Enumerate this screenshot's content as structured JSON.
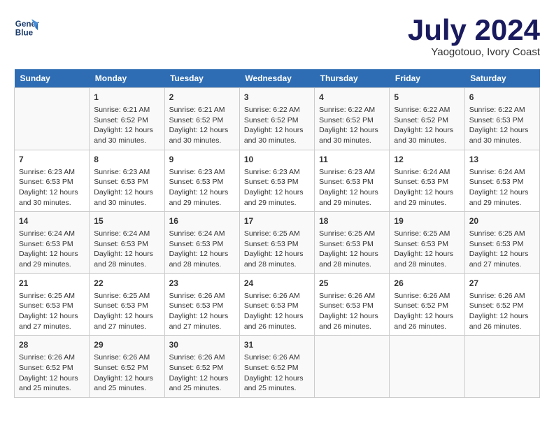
{
  "header": {
    "logo_line1": "General",
    "logo_line2": "Blue",
    "month": "July 2024",
    "location": "Yaogotouo, Ivory Coast"
  },
  "weekdays": [
    "Sunday",
    "Monday",
    "Tuesday",
    "Wednesday",
    "Thursday",
    "Friday",
    "Saturday"
  ],
  "weeks": [
    [
      {
        "day": "",
        "info": ""
      },
      {
        "day": "1",
        "info": "Sunrise: 6:21 AM\nSunset: 6:52 PM\nDaylight: 12 hours\nand 30 minutes."
      },
      {
        "day": "2",
        "info": "Sunrise: 6:21 AM\nSunset: 6:52 PM\nDaylight: 12 hours\nand 30 minutes."
      },
      {
        "day": "3",
        "info": "Sunrise: 6:22 AM\nSunset: 6:52 PM\nDaylight: 12 hours\nand 30 minutes."
      },
      {
        "day": "4",
        "info": "Sunrise: 6:22 AM\nSunset: 6:52 PM\nDaylight: 12 hours\nand 30 minutes."
      },
      {
        "day": "5",
        "info": "Sunrise: 6:22 AM\nSunset: 6:52 PM\nDaylight: 12 hours\nand 30 minutes."
      },
      {
        "day": "6",
        "info": "Sunrise: 6:22 AM\nSunset: 6:53 PM\nDaylight: 12 hours\nand 30 minutes."
      }
    ],
    [
      {
        "day": "7",
        "info": "Sunrise: 6:23 AM\nSunset: 6:53 PM\nDaylight: 12 hours\nand 30 minutes."
      },
      {
        "day": "8",
        "info": "Sunrise: 6:23 AM\nSunset: 6:53 PM\nDaylight: 12 hours\nand 30 minutes."
      },
      {
        "day": "9",
        "info": "Sunrise: 6:23 AM\nSunset: 6:53 PM\nDaylight: 12 hours\nand 29 minutes."
      },
      {
        "day": "10",
        "info": "Sunrise: 6:23 AM\nSunset: 6:53 PM\nDaylight: 12 hours\nand 29 minutes."
      },
      {
        "day": "11",
        "info": "Sunrise: 6:23 AM\nSunset: 6:53 PM\nDaylight: 12 hours\nand 29 minutes."
      },
      {
        "day": "12",
        "info": "Sunrise: 6:24 AM\nSunset: 6:53 PM\nDaylight: 12 hours\nand 29 minutes."
      },
      {
        "day": "13",
        "info": "Sunrise: 6:24 AM\nSunset: 6:53 PM\nDaylight: 12 hours\nand 29 minutes."
      }
    ],
    [
      {
        "day": "14",
        "info": "Sunrise: 6:24 AM\nSunset: 6:53 PM\nDaylight: 12 hours\nand 29 minutes."
      },
      {
        "day": "15",
        "info": "Sunrise: 6:24 AM\nSunset: 6:53 PM\nDaylight: 12 hours\nand 28 minutes."
      },
      {
        "day": "16",
        "info": "Sunrise: 6:24 AM\nSunset: 6:53 PM\nDaylight: 12 hours\nand 28 minutes."
      },
      {
        "day": "17",
        "info": "Sunrise: 6:25 AM\nSunset: 6:53 PM\nDaylight: 12 hours\nand 28 minutes."
      },
      {
        "day": "18",
        "info": "Sunrise: 6:25 AM\nSunset: 6:53 PM\nDaylight: 12 hours\nand 28 minutes."
      },
      {
        "day": "19",
        "info": "Sunrise: 6:25 AM\nSunset: 6:53 PM\nDaylight: 12 hours\nand 28 minutes."
      },
      {
        "day": "20",
        "info": "Sunrise: 6:25 AM\nSunset: 6:53 PM\nDaylight: 12 hours\nand 27 minutes."
      }
    ],
    [
      {
        "day": "21",
        "info": "Sunrise: 6:25 AM\nSunset: 6:53 PM\nDaylight: 12 hours\nand 27 minutes."
      },
      {
        "day": "22",
        "info": "Sunrise: 6:25 AM\nSunset: 6:53 PM\nDaylight: 12 hours\nand 27 minutes."
      },
      {
        "day": "23",
        "info": "Sunrise: 6:26 AM\nSunset: 6:53 PM\nDaylight: 12 hours\nand 27 minutes."
      },
      {
        "day": "24",
        "info": "Sunrise: 6:26 AM\nSunset: 6:53 PM\nDaylight: 12 hours\nand 26 minutes."
      },
      {
        "day": "25",
        "info": "Sunrise: 6:26 AM\nSunset: 6:53 PM\nDaylight: 12 hours\nand 26 minutes."
      },
      {
        "day": "26",
        "info": "Sunrise: 6:26 AM\nSunset: 6:52 PM\nDaylight: 12 hours\nand 26 minutes."
      },
      {
        "day": "27",
        "info": "Sunrise: 6:26 AM\nSunset: 6:52 PM\nDaylight: 12 hours\nand 26 minutes."
      }
    ],
    [
      {
        "day": "28",
        "info": "Sunrise: 6:26 AM\nSunset: 6:52 PM\nDaylight: 12 hours\nand 25 minutes."
      },
      {
        "day": "29",
        "info": "Sunrise: 6:26 AM\nSunset: 6:52 PM\nDaylight: 12 hours\nand 25 minutes."
      },
      {
        "day": "30",
        "info": "Sunrise: 6:26 AM\nSunset: 6:52 PM\nDaylight: 12 hours\nand 25 minutes."
      },
      {
        "day": "31",
        "info": "Sunrise: 6:26 AM\nSunset: 6:52 PM\nDaylight: 12 hours\nand 25 minutes."
      },
      {
        "day": "",
        "info": ""
      },
      {
        "day": "",
        "info": ""
      },
      {
        "day": "",
        "info": ""
      }
    ]
  ]
}
